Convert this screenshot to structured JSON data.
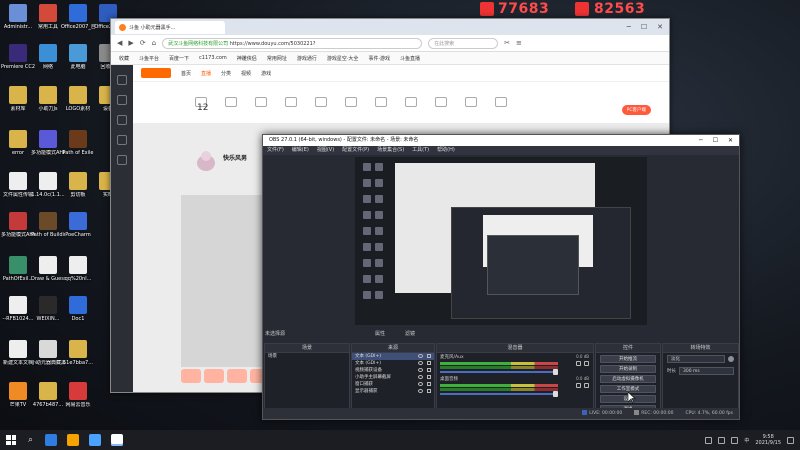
{
  "overlay": {
    "qq_text_1": "77683",
    "qq_text_2": "82563"
  },
  "desktop": {
    "icons": [
      {
        "label": "Administr...",
        "color": "#6b8fd6"
      },
      {
        "label": "常用工具",
        "color": "#d44a3a"
      },
      {
        "label": "Office2007_自打开",
        "color": "#2f6bd9"
      },
      {
        "label": "Office2016",
        "color": "#2e5cbf"
      },
      {
        "label": "Premiere CC2019",
        "color": "#3a2a7a"
      },
      {
        "label": "网络",
        "color": "#3a8fd6"
      },
      {
        "label": "此电脑",
        "color": "#4a9ad8"
      },
      {
        "label": "回收站",
        "color": "#8a8a8a"
      },
      {
        "label": "素材库",
        "color": "#d9b44a"
      },
      {
        "label": "小助力Js",
        "color": "#d9b44a"
      },
      {
        "label": "LOGO素材",
        "color": "#d9b44a"
      },
      {
        "label": "设备",
        "color": "#d9b44a"
      },
      {
        "label": "error",
        "color": "#d9b44a"
      },
      {
        "label": "多功能模式AHK",
        "color": "#5a5ad9"
      },
      {
        "label": "Path of Exile",
        "color": "#6b3a1a"
      },
      {
        "label": "文件属性传输",
        "color": "#eeeeee"
      },
      {
        "label": "1.14.0c(1.1...",
        "color": "#eeeeee"
      },
      {
        "label": "剪切板",
        "color": "#d9b44a"
      },
      {
        "label": "实时",
        "color": "#d9b44a"
      },
      {
        "label": "多功能模式AHK20.19...",
        "color": "#c43a3a"
      },
      {
        "label": "Path of Building",
        "color": "#6b4a2a"
      },
      {
        "label": "PoeCharm",
        "color": "#3a6bd9"
      },
      {
        "label": "PathOfExil...",
        "color": "#3a8f6b"
      },
      {
        "label": "Draw & Guess",
        "color": "#eeeeee"
      },
      {
        "label": "qq%20nl...",
        "color": "#eeeeee"
      },
      {
        "label": "--RFB1024...",
        "color": "#eeeeee"
      },
      {
        "label": "WEIXIN...",
        "color": "#2a2a2a"
      },
      {
        "label": "Doc1",
        "color": "#2f6bd9"
      },
      {
        "label": "新建文本文档",
        "color": "#eeeeee"
      },
      {
        "label": "小助元器典藏黑手",
        "color": "#d9d9d9"
      },
      {
        "label": "51e7bba7...",
        "color": "#d9b44a"
      },
      {
        "label": "芒果TV",
        "color": "#f08a24"
      },
      {
        "label": "4767b487...",
        "color": "#d9b44a"
      },
      {
        "label": "网易云音乐",
        "color": "#d63a3a"
      }
    ]
  },
  "browser": {
    "tab_title": "斗鱼 小助元器黑手...",
    "url": "https://www.douyu.com/5030221?",
    "url_prefix": "武汉斗鱼网络科技有限公司",
    "search_placeholder": "在此搜索",
    "bookmarks": [
      "收藏",
      "斗鱼平台",
      "百度一下",
      "c1173.com",
      "神雕侠侣",
      "常用网址",
      "游戏通行",
      "游戏星空·大全",
      "事件·游戏",
      "斗鱼直播"
    ],
    "header": {
      "home": "首页",
      "live": "直播",
      "category": "分类",
      "video": "视频",
      "game": "游戏"
    },
    "count": "12",
    "room_title": "快乐风男",
    "pc_button": "PC客户端"
  },
  "obs": {
    "title": "OBS 27.0.1 (64-bit, windows) - 配置文件: 未命名 - 场景: 未命名",
    "menu": [
      "文件(F)",
      "编辑(E)",
      "视图(V)",
      "配置文件(P)",
      "场景集合(S)",
      "工具(T)",
      "帮助(H)"
    ],
    "source_label": "未选择源",
    "props_btn": "属性",
    "filters_btn": "滤镜",
    "panels": {
      "scenes": {
        "title": "场景",
        "items": [
          "场景"
        ]
      },
      "sources": {
        "title": "来源",
        "items": [
          "文本 (GDI+)",
          "文本 (GDI+)",
          "视频捕获设备",
          "小助手主屏幕截屏",
          "窗口捕获",
          "显示器捕获"
        ]
      },
      "mixer": {
        "title": "混音器",
        "channels": [
          {
            "name": "麦克风/Aux",
            "db": "0.0 dB"
          },
          {
            "name": "桌面音频",
            "db": "0.0 dB"
          }
        ]
      },
      "controls": {
        "title": "控件",
        "buttons": [
          "开始推流",
          "开始录制",
          "启动虚拟摄像机",
          "工作室模式",
          "设置",
          "退出"
        ]
      },
      "transitions": {
        "title": "转场特效",
        "type": "淡化",
        "duration_label": "时长",
        "duration": "300 ms"
      }
    },
    "status": {
      "live": "LIVE: 00:00:00",
      "rec": "REC: 00:00:00",
      "cpu": "CPU: 4.7%, 60.00 fps"
    }
  },
  "taskbar": {
    "time": "9:58",
    "date": "2021/9/15",
    "lang": "中",
    "apps": [
      "#2f7de1",
      "#f6a300",
      "#4aa3ff",
      "#ffffff"
    ]
  }
}
